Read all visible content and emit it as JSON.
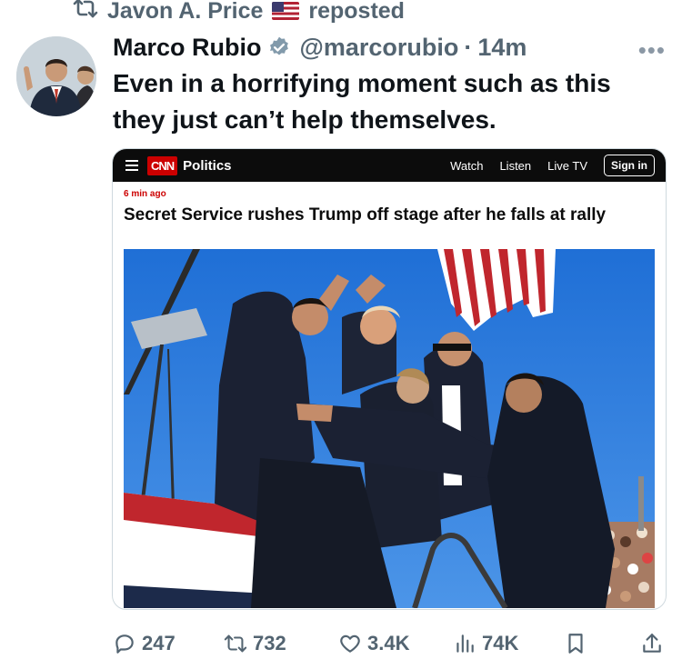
{
  "repost": {
    "user": "Javon A. Price",
    "label": "reposted"
  },
  "tweet": {
    "author_name": "Marco Rubio",
    "handle": "@marcorubio",
    "separator": "·",
    "time": "14m",
    "more": "•••",
    "text": "Even in a horrifying moment such as this they just can’t help themselves."
  },
  "card": {
    "logo": "CNN",
    "section": "Politics",
    "nav": [
      "Watch",
      "Listen",
      "Live TV"
    ],
    "sign_in": "Sign in",
    "time_ago": "6 min ago",
    "headline": "Secret Service rushes Trump off stage after he falls at rally"
  },
  "actions": {
    "replies": "247",
    "reposts": "732",
    "likes": "3.4K",
    "views": "74K"
  },
  "colors": {
    "text": "#0f1419",
    "muted": "#536471",
    "verified": "#829aab",
    "cnn_red": "#cc0000"
  }
}
